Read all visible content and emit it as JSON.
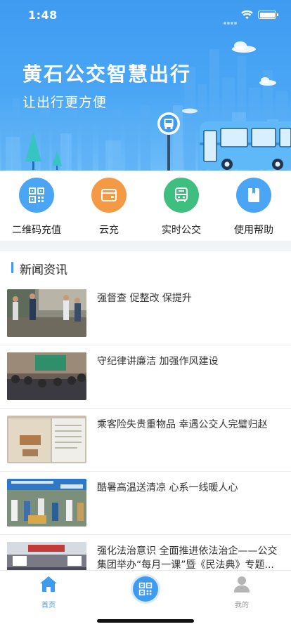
{
  "status_bar": {
    "time": "1:48",
    "icons": [
      "signal-dots",
      "wifi-icon",
      "battery-icon"
    ]
  },
  "banner": {
    "title": "黄石公交智慧出行",
    "subtitle": "让出行更方便",
    "colors": {
      "sky_top": "#3f9bf0",
      "sky_bottom": "#6cbcf8",
      "bus": "#5fb8f7"
    }
  },
  "quick_actions": [
    {
      "label": "二维码充值",
      "icon": "qr-code-icon",
      "color": "#4aa6f5"
    },
    {
      "label": "云充",
      "icon": "wallet-icon",
      "color": "#f49a45"
    },
    {
      "label": "实时公交",
      "icon": "bus-icon",
      "color": "#3fbf7f"
    },
    {
      "label": "使用帮助",
      "icon": "book-icon",
      "color": "#4aa6f5"
    }
  ],
  "news": {
    "section_title": "新闻资讯",
    "items": [
      {
        "title": "强督查 促整改 保提升"
      },
      {
        "title": "守纪律讲廉洁 加强作风建设"
      },
      {
        "title": "乘客险失贵重物品 幸遇公交人完璧归赵"
      },
      {
        "title": "酷暑高温送清凉 心系一线暖人心"
      },
      {
        "title": "强化法治意识 全面推进依法治企——公交集团举办“每月一课”暨《民法典》专题..."
      }
    ]
  },
  "tabbar": {
    "items": [
      {
        "label": "首页",
        "icon": "home-icon",
        "active": true
      },
      {
        "label": "",
        "icon": "qr-code-icon",
        "active": false
      },
      {
        "label": "我的",
        "icon": "user-icon",
        "active": false
      }
    ],
    "active_color": "#3f9bf0",
    "inactive_color": "#999999"
  }
}
